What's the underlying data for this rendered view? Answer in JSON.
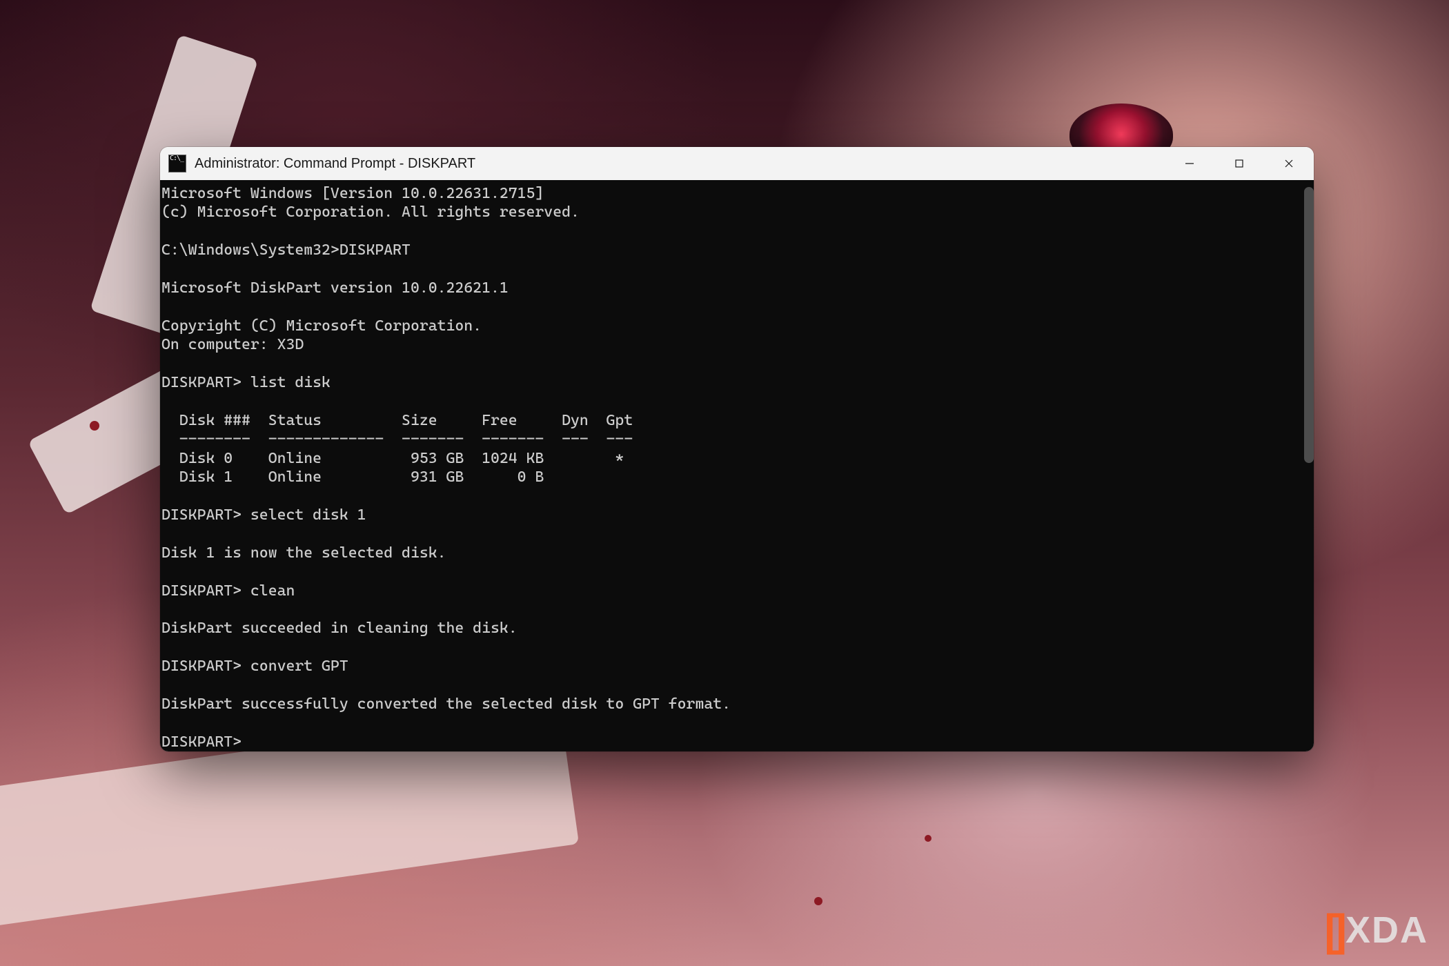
{
  "window": {
    "title": "Administrator: Command Prompt - DISKPART"
  },
  "terminal": {
    "lines": [
      "Microsoft Windows [Version 10.0.22631.2715]",
      "(c) Microsoft Corporation. All rights reserved.",
      "",
      "C:\\Windows\\System32>DISKPART",
      "",
      "Microsoft DiskPart version 10.0.22621.1",
      "",
      "Copyright (C) Microsoft Corporation.",
      "On computer: X3D",
      "",
      "DISKPART> list disk",
      "",
      "  Disk ###  Status         Size     Free     Dyn  Gpt",
      "  --------  -------------  -------  -------  ---  ---",
      "  Disk 0    Online          953 GB  1024 KB        *",
      "  Disk 1    Online          931 GB      0 B",
      "",
      "DISKPART> select disk 1",
      "",
      "Disk 1 is now the selected disk.",
      "",
      "DISKPART> clean",
      "",
      "DiskPart succeeded in cleaning the disk.",
      "",
      "DISKPART> convert GPT",
      "",
      "DiskPart successfully converted the selected disk to GPT format.",
      "",
      "DISKPART>"
    ],
    "history": {
      "os_version_line": "Microsoft Windows [Version 10.0.22631.2715]",
      "diskpart_version": "10.0.22621.1",
      "computer_name": "X3D",
      "commands": [
        "DISKPART",
        "list disk",
        "select disk 1",
        "clean",
        "convert GPT"
      ],
      "disk_table": {
        "columns": [
          "Disk ###",
          "Status",
          "Size",
          "Free",
          "Dyn",
          "Gpt"
        ],
        "rows": [
          {
            "disk": "Disk 0",
            "status": "Online",
            "size": "953 GB",
            "free": "1024 KB",
            "dyn": "",
            "gpt": "*"
          },
          {
            "disk": "Disk 1",
            "status": "Online",
            "size": "931 GB",
            "free": "0 B",
            "dyn": "",
            "gpt": ""
          }
        ]
      },
      "responses": [
        "Disk 1 is now the selected disk.",
        "DiskPart succeeded in cleaning the disk.",
        "DiskPart successfully converted the selected disk to GPT format."
      ],
      "current_prompt": "DISKPART>"
    }
  },
  "watermark": {
    "brand": "XDA"
  }
}
